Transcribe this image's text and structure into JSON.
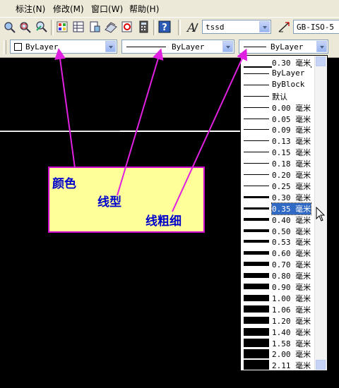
{
  "menu": {
    "items": [
      "标注(N)",
      "修改(M)",
      "窗口(W)",
      "帮助(H)"
    ]
  },
  "style_toolbar": {
    "text_style": "tssd",
    "dim_style": "GB-ISO-5"
  },
  "properties": {
    "color_value": "ByLayer",
    "linetype_value": "ByLayer",
    "lineweight_value": "ByLayer"
  },
  "lineweight_list": {
    "items": [
      "0.30 毫米",
      "ByLayer",
      "ByBlock",
      "默认",
      "0.00 毫米",
      "0.05 毫米",
      "0.09 毫米",
      "0.13 毫米",
      "0.15 毫米",
      "0.18 毫米",
      "0.20 毫米",
      "0.25 毫米",
      "0.30 毫米",
      "0.35 毫米",
      "0.40 毫米",
      "0.50 毫米",
      "0.53 毫米",
      "0.60 毫米",
      "0.70 毫米",
      "0.80 毫米",
      "0.90 毫米",
      "1.00 毫米",
      "1.06 毫米",
      "1.20 毫米",
      "1.40 毫米",
      "1.58 毫米",
      "2.00 毫米",
      "2.11 毫米"
    ],
    "selected": "0.35 毫米"
  },
  "callout": {
    "color_label": "颜色",
    "linetype_label": "线型",
    "lineweight_label": "线粗细"
  },
  "colors": {
    "arrow": "#e020e0",
    "callout_bg": "#ffff99",
    "callout_text": "#0000cc",
    "selection": "#316ac5"
  }
}
